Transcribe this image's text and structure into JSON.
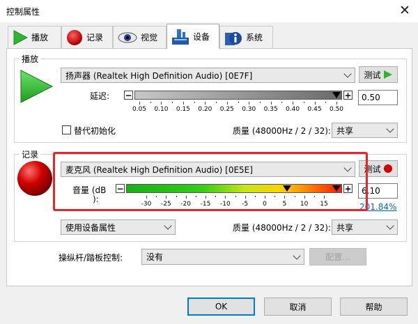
{
  "window": {
    "title": "控制属性",
    "close_glyph": "✕"
  },
  "tabs": [
    {
      "label": "播放",
      "icon": "play-icon",
      "active": false
    },
    {
      "label": "记录",
      "icon": "record-icon",
      "active": false
    },
    {
      "label": "视觉",
      "icon": "eye-icon",
      "active": false
    },
    {
      "label": "设备",
      "icon": "device-icon",
      "active": true
    },
    {
      "label": "系统",
      "icon": "system-info-icon",
      "active": false
    }
  ],
  "playback": {
    "group_label": "播放",
    "device": "扬声器 (Realtek High Definition Audio) [0E7F]",
    "test_label": "测试",
    "delay_label": "延迟:",
    "delay_value": "0.50",
    "delay_ticks": [
      "0.05",
      "0.10",
      "0.15",
      "0.20",
      "0.25",
      "0.30",
      "0.35",
      "0.40",
      "0.45",
      "0.50"
    ],
    "delay_level": 1.0,
    "checkbox_label": "替代初始化",
    "checkbox_checked": false,
    "quality_label": "质量 (48000Hz / 2 / 32):",
    "mode": "共享"
  },
  "record": {
    "group_label": "记录",
    "device": "麦克风 (Realtek High Definition Audio) [0E5E]",
    "test_label": "测试",
    "volume_label_line1": "音量 (dB",
    "volume_label_line2": "):",
    "volume_value": "6.10",
    "volume_percent": "201.84%",
    "volume_ticks": [
      "-30",
      "-25",
      "-20",
      "-15",
      "-10",
      "-5",
      "0",
      "5",
      "10",
      "15"
    ],
    "option": "使用设备属性",
    "quality_label": "质量 (48000Hz / 2 / 32):",
    "mode": "共享"
  },
  "joystick": {
    "label": "操纵杆/踏板控制:",
    "value": "没有",
    "config_label": "配置..."
  },
  "footer": {
    "ok": "OK",
    "cancel": "取消",
    "help": "帮助"
  },
  "colors": {
    "play_green": "#2fb52f",
    "record_red": "#c00000",
    "highlight": "#e5262b",
    "link_blue": "#0066cc"
  }
}
